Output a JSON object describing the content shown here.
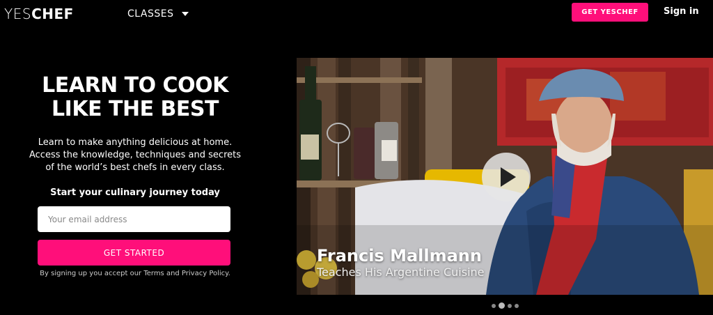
{
  "brand": {
    "logo_light": "YES",
    "logo_bold": "CHEF"
  },
  "nav": {
    "classes_label": "CLASSES",
    "get_button": "GET YESCHEF",
    "signin": "Sign in"
  },
  "hero": {
    "title_line1": "LEARN TO COOK",
    "title_line2": "LIKE THE BEST",
    "subtitle_line1": "Learn to make anything delicious at home.",
    "subtitle_line2": "Access the knowledge, techniques and secrets",
    "subtitle_line3": "of the world’s best chefs in every class.",
    "journey": "Start your culinary journey today",
    "email_placeholder": "Your email address",
    "start_button": "GET STARTED",
    "terms": "By signing up you accept our Terms and Privacy Policy."
  },
  "video": {
    "chef_name": "Francis Mallmann",
    "chef_subtitle": "Teaches His Argentine Cuisine"
  },
  "carousel": {
    "dot_count": 4,
    "active_index": 1
  },
  "colors": {
    "accent": "#ff0f7a",
    "background": "#000000"
  },
  "icons": {
    "classes_dropdown": "caret-down-icon",
    "play": "play-icon"
  }
}
